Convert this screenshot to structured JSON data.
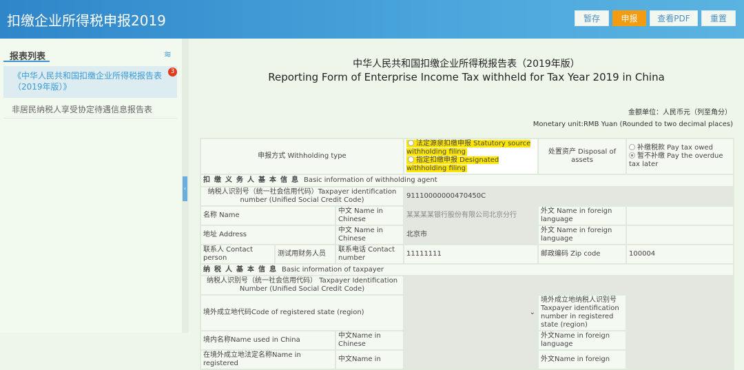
{
  "header": {
    "title": "扣缴企业所得税申报2019",
    "buttons": [
      "暂存",
      "申报",
      "查看PDF",
      "重置"
    ]
  },
  "sidebar": {
    "title": "报表列表",
    "items": [
      {
        "label": "《中华人民共和国扣缴企业所得税报告表（2019年版）》",
        "badge": "3"
      },
      {
        "label": "非居民纳税人享受协定待遇信息报告表"
      }
    ]
  },
  "form": {
    "title_cn": "中华人民共和国扣缴企业所得税报告表（2019年版）",
    "title_en": "Reporting Form of Enterprise Income Tax withheld for Tax Year 2019 in China",
    "unit_cn": "金额单位：人民币元（列至角分）",
    "unit_en": "Monetary unit:RMB Yuan (Rounded to two decimal places)",
    "withholding_type_label": "申报方式 Withholding type",
    "wt_option1": "法定源泉扣缴申报  Statutory source withholding filing",
    "wt_option2": "指定扣缴申报 Designated withholding filing",
    "disposal_label": "处置资产 Disposal of assets",
    "disposal_option1": "补缴税款 Pay tax owed",
    "disposal_option2": "暂不补缴 Pay the overdue tax later",
    "agent_section_cn": "扣缴义务人基本信息",
    "agent_section_en": "Basic information of withholding agent",
    "agent_tin_label": "纳税人识别号（统一社会信用代码）Taxpayer identification number (Unified Social Credit Code)",
    "agent_tin_value": "91110000000470450C",
    "name_label": "名称  Name",
    "cn_name_label": "中文  Name in Chinese",
    "foreign_name_label": "外文  Name in foreign language",
    "agent_name_value": "某某某某银行股份有限公司北京分行",
    "address_label": "地址  Address",
    "address_value": "北京市",
    "contact_label": "联系人 Contact person",
    "contact_value": "测试用财务人员",
    "phone_label": "联系电话 Contact number",
    "phone_value": "11111111",
    "zip_label": "邮政编码  Zip code",
    "zip_value": "100004",
    "taxpayer_section_cn": "纳税人基本信息",
    "taxpayer_section_en": "Basic information of taxpayer",
    "taxpayer_tin_label": "纳税人识别号（统一社会信用代码） Taxpayer Identification Number (Unified Social Credit Code)",
    "reg_code_label": "境外成立地代码Code of registered state (region)",
    "reg_tin_label": "境外成立地纳税人识别号 Taxpayer identification number in registered state (region)",
    "china_name_label": "境内名称Name used in China",
    "cn_name_label2": "中文Name in Chinese",
    "foreign_name_label2": "外文Name in foreign language",
    "reg_name_label": "在境外成立地法定名称Name in registered",
    "cn_name_label3": "中文Name in",
    "foreign_name_label3": "外文Name in foreign"
  }
}
